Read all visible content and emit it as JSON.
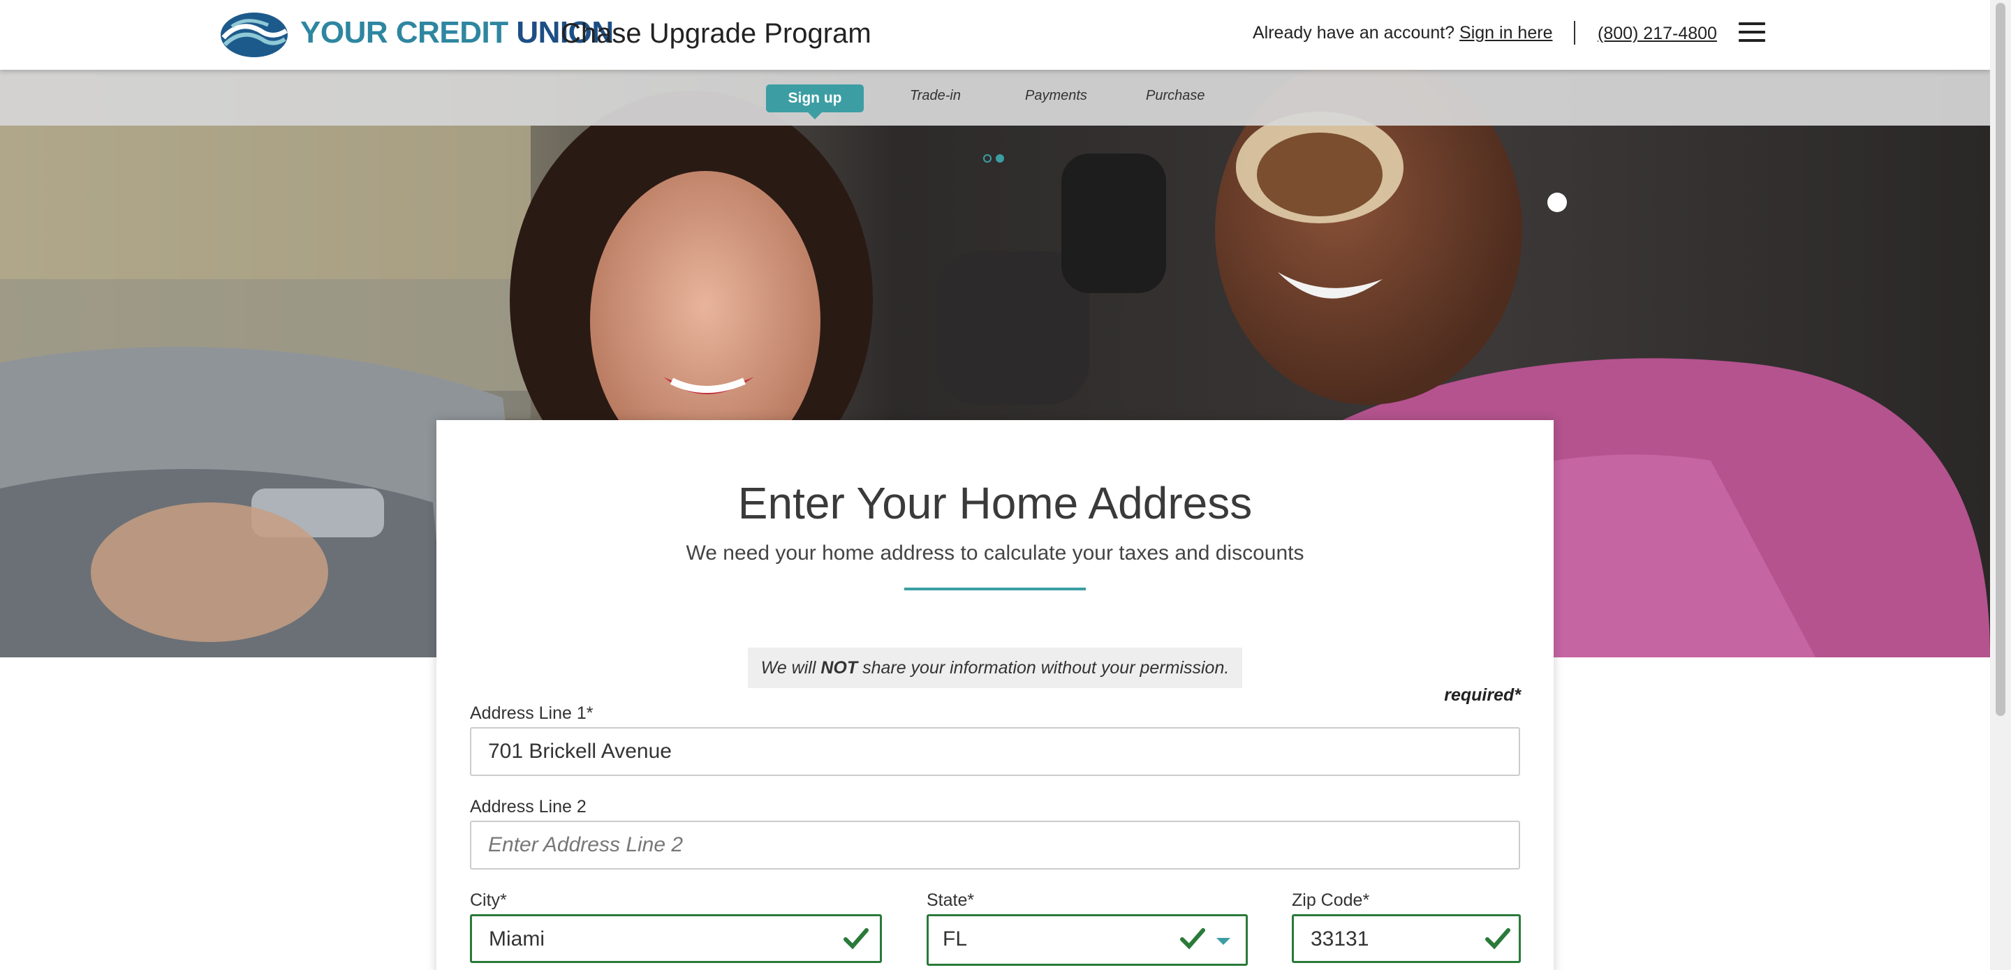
{
  "header": {
    "brand_prefix": "YOUR CREDIT ",
    "brand_suffix": "UNION",
    "program": "Chase Upgrade Program",
    "account_prompt": "Already have an account?",
    "sign_in": "Sign in here",
    "phone": "(800) 217-4800",
    "menu_icon": "hamburger-menu-icon"
  },
  "steps": {
    "items": [
      "Sign up",
      "Trade-in",
      "Payments",
      "Purchase"
    ],
    "active_index": 0
  },
  "carousel": {
    "count": 2,
    "active": 1
  },
  "form": {
    "title": "Enter Your Home Address",
    "subtitle": "We need your home address to calculate your taxes and discounts",
    "privacy_pre": "We will ",
    "privacy_strong": "NOT",
    "privacy_post": " share your information without your permission.",
    "required_note": "required*",
    "address1": {
      "label": "Address Line 1*",
      "value": "701 Brickell Avenue"
    },
    "address2": {
      "label": "Address Line 2",
      "placeholder": "Enter Address Line 2"
    },
    "city": {
      "label": "City*",
      "value": "Miami",
      "valid": true
    },
    "state": {
      "label": "State*",
      "value": "FL",
      "valid": true
    },
    "zip": {
      "label": "Zip Code*",
      "value": "33131",
      "valid": true
    }
  },
  "colors": {
    "accent": "#3c9ea3",
    "valid": "#2a7a3a",
    "brand_blue": "#1d4f86",
    "brand_teal": "#2e86a0"
  }
}
